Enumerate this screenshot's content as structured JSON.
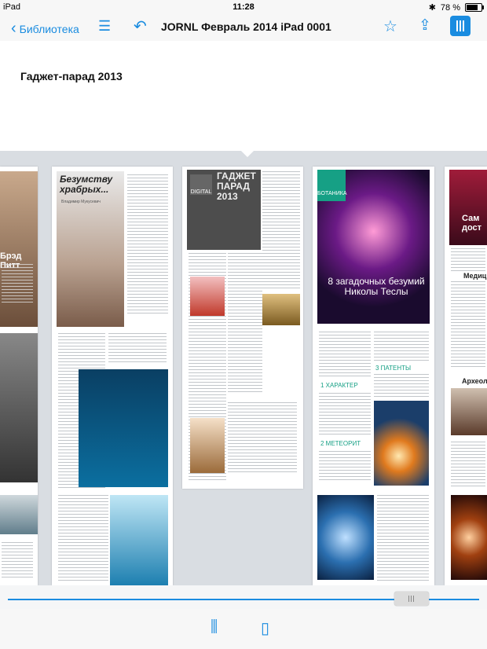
{
  "status": {
    "device": "iPad",
    "time": "11:28",
    "battery": "78 %",
    "battery_level": 0.78
  },
  "nav": {
    "back_label": "Библиотека",
    "title": "JORNL Февраль 2014 iPad 0001"
  },
  "section": {
    "title": "Гаджет-парад 2013"
  },
  "pages": {
    "p1_title": "Безумству храбрых...",
    "p1_author": "Владимир Мукусевич",
    "p0_title": "Брэд Питт",
    "p2_title": "ГАДЖЕТ ПАРАД 2013",
    "p2_tag": "DIGITAL",
    "p3_title": "8 загадочных безумий Николы Теслы",
    "p3_tag": "БОТАНИКА",
    "p3_h1": "1 ХАРАКТЕР",
    "p3_h2": "2 МЕТЕОРИТ",
    "p3_h3": "3 ПАТЕНТЫ",
    "p4_h": "Медиц",
    "p4_h2": "Археоло",
    "p4_title": "Сам дост"
  }
}
